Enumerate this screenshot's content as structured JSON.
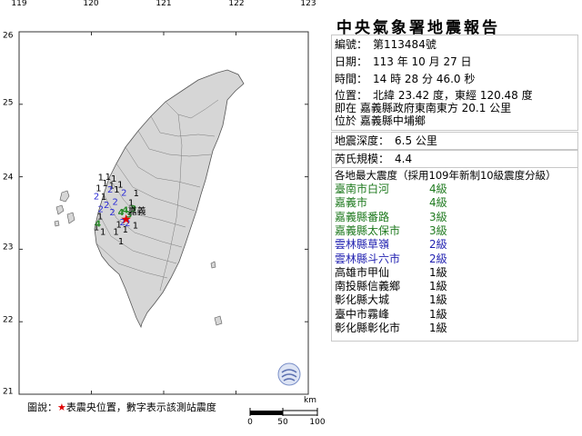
{
  "map": {
    "lon_labels": [
      "119",
      "120",
      "121",
      "122",
      "123"
    ],
    "lat_labels": [
      "26",
      "25",
      "24",
      "23",
      "22",
      "21"
    ],
    "epicenter_label": "嘉義",
    "colors": {
      "land": "#d6d6d6",
      "sea": "#ffffff",
      "grid": "#6a6a6a",
      "star": "#e00000",
      "int1": "#000000",
      "int2": "#2b2bd6",
      "int3": "#2a8a2a",
      "int4": "#2a8a2a"
    },
    "stations": [
      {
        "lon": 120.13,
        "lat": 23.95,
        "intensity": "1"
      },
      {
        "lon": 120.23,
        "lat": 23.96,
        "intensity": "1"
      },
      {
        "lon": 120.31,
        "lat": 23.93,
        "intensity": "1"
      },
      {
        "lon": 120.19,
        "lat": 23.87,
        "intensity": "1"
      },
      {
        "lon": 120.28,
        "lat": 23.84,
        "intensity": "1"
      },
      {
        "lon": 120.4,
        "lat": 23.85,
        "intensity": "1"
      },
      {
        "lon": 120.35,
        "lat": 23.78,
        "intensity": "1"
      },
      {
        "lon": 120.1,
        "lat": 23.8,
        "intensity": "1"
      },
      {
        "lon": 120.62,
        "lat": 23.73,
        "intensity": "1"
      },
      {
        "lon": 120.17,
        "lat": 23.68,
        "intensity": "1"
      },
      {
        "lon": 120.26,
        "lat": 23.78,
        "intensity": "2"
      },
      {
        "lon": 120.45,
        "lat": 23.74,
        "intensity": "2"
      },
      {
        "lon": 120.07,
        "lat": 23.69,
        "intensity": "2"
      },
      {
        "lon": 120.21,
        "lat": 23.57,
        "intensity": "2"
      },
      {
        "lon": 120.33,
        "lat": 23.61,
        "intensity": "2"
      },
      {
        "lon": 120.13,
        "lat": 23.51,
        "intensity": "2"
      },
      {
        "lon": 120.29,
        "lat": 23.47,
        "intensity": "2"
      },
      {
        "lon": 120.43,
        "lat": 23.33,
        "intensity": "2"
      },
      {
        "lon": 120.5,
        "lat": 23.32,
        "intensity": "2"
      },
      {
        "lon": 120.55,
        "lat": 23.6,
        "intensity": "1"
      },
      {
        "lon": 120.12,
        "lat": 23.41,
        "intensity": "1"
      },
      {
        "lon": 120.38,
        "lat": 23.3,
        "intensity": "1"
      },
      {
        "lon": 120.61,
        "lat": 23.29,
        "intensity": "1"
      },
      {
        "lon": 120.47,
        "lat": 23.23,
        "intensity": "1"
      },
      {
        "lon": 120.07,
        "lat": 23.26,
        "intensity": "1"
      },
      {
        "lon": 120.16,
        "lat": 23.2,
        "intensity": "1"
      },
      {
        "lon": 120.34,
        "lat": 23.2,
        "intensity": "1"
      },
      {
        "lon": 120.41,
        "lat": 23.07,
        "intensity": "1"
      },
      {
        "lon": 120.52,
        "lat": 23.44,
        "intensity": "3"
      },
      {
        "lon": 120.47,
        "lat": 23.5,
        "intensity": "4"
      },
      {
        "lon": 120.41,
        "lat": 23.47,
        "intensity": "4"
      },
      {
        "lon": 120.09,
        "lat": 23.31,
        "intensity": "4"
      },
      {
        "lon": 120.58,
        "lat": 23.52,
        "intensity": "3"
      }
    ]
  },
  "report": {
    "title": "中央氣象署地震報告",
    "number_label": "編號：",
    "number": "第113484號",
    "date_label": "日期：",
    "date": "113 年 10 月 27 日",
    "time_label": "時間：",
    "time": "14 時 28 分 46.0 秒",
    "position_label": "位置：",
    "position": "北緯 23.42 度，東經 120.48 度",
    "position_line2": "即在 嘉義縣政府東南東方 20.1 公里",
    "position_line3": "位於 嘉義縣中埔鄉",
    "depth_label": "地震深度：",
    "depth": "6.5 公里",
    "magnitude_label": "芮氏規模：",
    "magnitude": "4.4",
    "intensity_header": "各地最大震度（採用109年新制10級震度分級）",
    "intensities": [
      {
        "place": "臺南市白河",
        "level": "4級",
        "color": "#1f7a1f"
      },
      {
        "place": "嘉義市",
        "level": "4級",
        "color": "#1f7a1f"
      },
      {
        "place": "嘉義縣番路",
        "level": "3級",
        "color": "#1f7a1f"
      },
      {
        "place": "嘉義縣太保市",
        "level": "3級",
        "color": "#1f7a1f"
      },
      {
        "place": "雲林縣草嶺",
        "level": "2級",
        "color": "#1f1fb0"
      },
      {
        "place": "雲林縣斗六市",
        "level": "2級",
        "color": "#1f1fb0"
      },
      {
        "place": "高雄市甲仙",
        "level": "1級",
        "color": "#000000"
      },
      {
        "place": "南投縣信義鄉",
        "level": "1級",
        "color": "#000000"
      },
      {
        "place": "彰化縣大城",
        "level": "1級",
        "color": "#000000"
      },
      {
        "place": "臺中市霧峰",
        "level": "1級",
        "color": "#000000"
      },
      {
        "place": "彰化縣彰化市",
        "level": "1級",
        "color": "#000000"
      }
    ]
  },
  "legend": {
    "prefix": "圖說：",
    "star": "★",
    "text": "表震央位置，數字表示該測站震度"
  },
  "scale": {
    "unit": "km",
    "labels": [
      "0",
      "50",
      "100"
    ]
  }
}
